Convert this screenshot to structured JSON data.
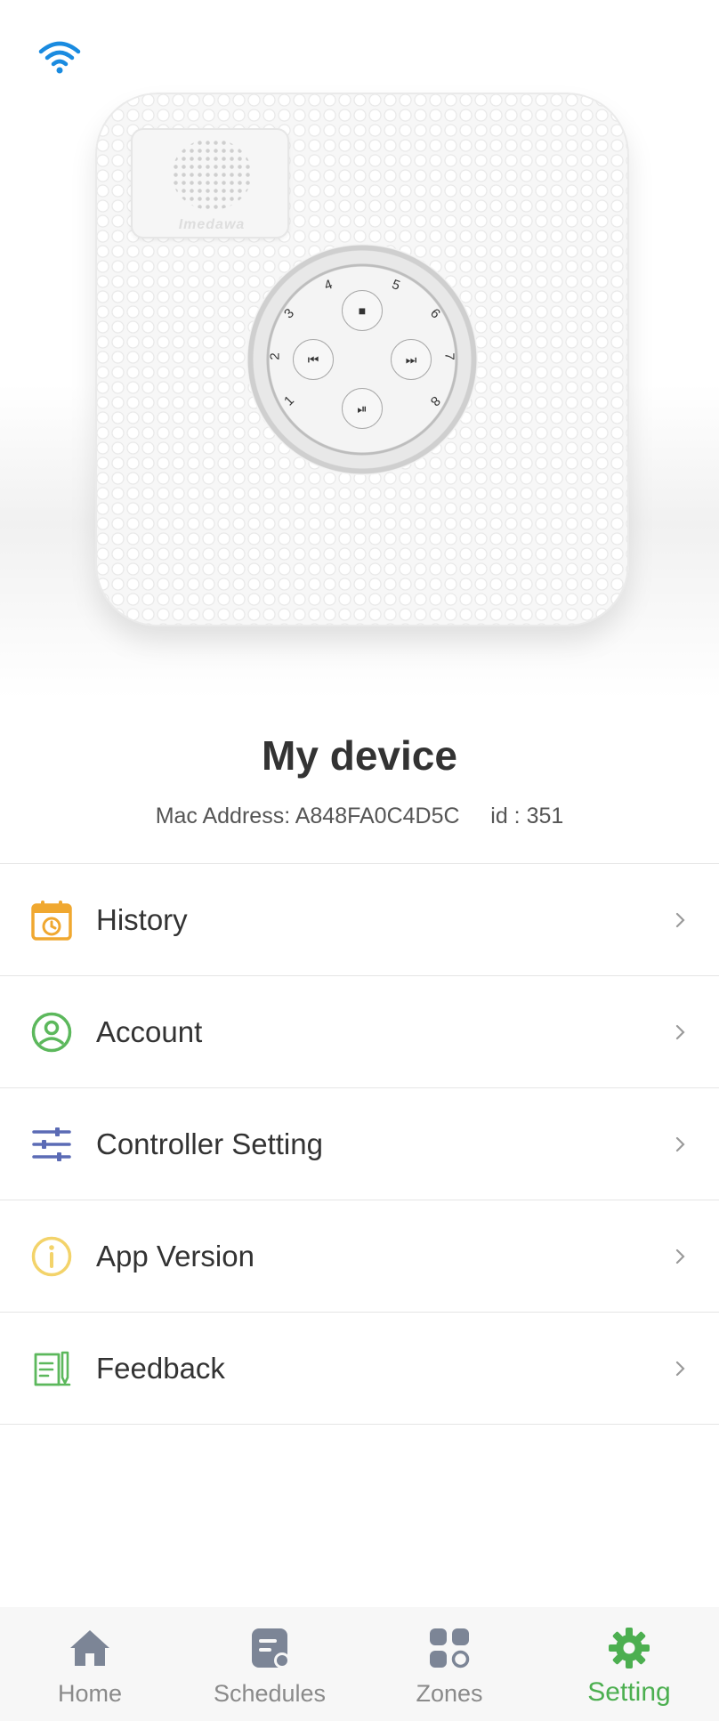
{
  "device": {
    "name": "My device",
    "mac_label": "Mac Address: A848FA0C4D5C",
    "id_label": "id : 351",
    "brand": "Imedawa",
    "zone_numbers": [
      "1",
      "2",
      "3",
      "4",
      "5",
      "6",
      "7",
      "8"
    ],
    "controls": [
      "stop-icon",
      "previous-icon",
      "next-icon",
      "play-pause-icon"
    ]
  },
  "status": {
    "wifi_icon": "wifi-icon",
    "color": "#1a8be0"
  },
  "menu": {
    "items": [
      {
        "label": "History",
        "icon": "history-calendar-icon",
        "color": "#f0a830"
      },
      {
        "label": "Account",
        "icon": "account-icon",
        "color": "#5cb85c"
      },
      {
        "label": "Controller Setting",
        "icon": "sliders-icon",
        "color": "#5b6bb5"
      },
      {
        "label": "App Version",
        "icon": "info-icon",
        "color": "#f3d36a"
      },
      {
        "label": "Feedback",
        "icon": "feedback-icon",
        "color": "#5cb85c"
      }
    ]
  },
  "tabbar": {
    "active": "Setting",
    "active_color": "#4caf50",
    "inactive_color": "#8a8a8a",
    "tabs": [
      {
        "label": "Home",
        "icon": "home-icon"
      },
      {
        "label": "Schedules",
        "icon": "schedules-icon"
      },
      {
        "label": "Zones",
        "icon": "zones-icon"
      },
      {
        "label": "Setting",
        "icon": "gear-icon"
      }
    ]
  }
}
